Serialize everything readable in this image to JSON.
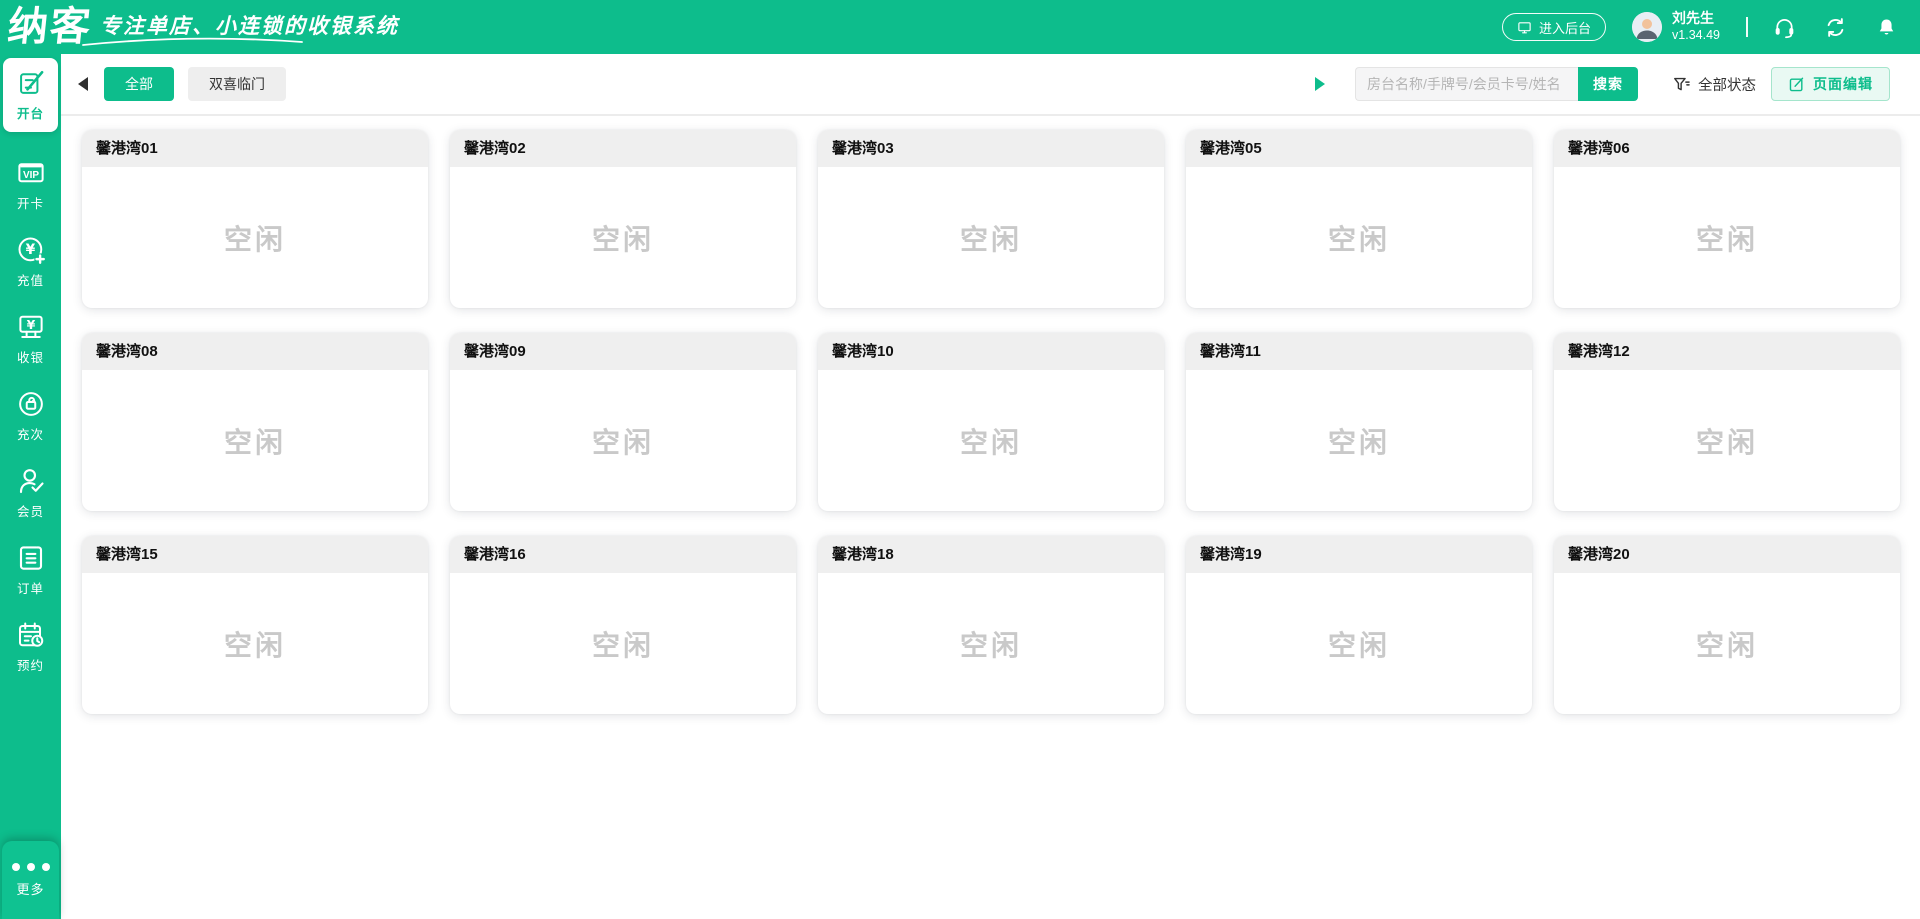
{
  "app": {
    "logo": "纳客",
    "slogan": "专注单店、小连锁的收银系统"
  },
  "header": {
    "backstage_button": "进入后台",
    "user": {
      "name": "刘先生",
      "version": "v1.34.49"
    },
    "icons": [
      "monitor-icon",
      "avatar",
      "headset-icon",
      "sync-icon",
      "bell-icon"
    ]
  },
  "sidebar": {
    "items": [
      {
        "label": "开台",
        "icon": "open-table-edit-icon",
        "active": true
      },
      {
        "label": "开卡",
        "icon": "vip-card-icon",
        "badge_text": "VIP",
        "active": false
      },
      {
        "label": "充值",
        "icon": "recharge-yen-plus-icon",
        "currency_glyph": "¥",
        "active": false
      },
      {
        "label": "收银",
        "icon": "cashier-monitor-icon",
        "currency_glyph": "¥",
        "active": false
      },
      {
        "label": "充次",
        "icon": "recharge-times-icon",
        "active": false
      },
      {
        "label": "会员",
        "icon": "member-check-icon",
        "active": false
      },
      {
        "label": "订单",
        "icon": "orders-clipboard-icon",
        "active": false
      },
      {
        "label": "预约",
        "icon": "reservation-calendar-clock-icon",
        "active": false
      }
    ],
    "more": {
      "label": "更多",
      "icon": "ellipsis-icon"
    }
  },
  "toolbar": {
    "tabs": [
      {
        "label": "全部",
        "active": true
      },
      {
        "label": "双喜临门",
        "active": false
      }
    ],
    "search": {
      "placeholder": "房台名称/手牌号/会员卡号/姓名",
      "button": "搜索"
    },
    "status_filter": {
      "label": "全部状态",
      "icon": "filter-funnel-icon"
    },
    "page_edit": {
      "label": "页面编辑",
      "icon": "edit-square-icon"
    }
  },
  "rooms": {
    "cards": [
      {
        "name": "馨港湾01",
        "status": "空闲"
      },
      {
        "name": "馨港湾02",
        "status": "空闲"
      },
      {
        "name": "馨港湾03",
        "status": "空闲"
      },
      {
        "name": "馨港湾05",
        "status": "空闲"
      },
      {
        "name": "馨港湾06",
        "status": "空闲"
      },
      {
        "name": "馨港湾08",
        "status": "空闲"
      },
      {
        "name": "馨港湾09",
        "status": "空闲"
      },
      {
        "name": "馨港湾10",
        "status": "空闲"
      },
      {
        "name": "馨港湾11",
        "status": "空闲"
      },
      {
        "name": "馨港湾12",
        "status": "空闲"
      },
      {
        "name": "馨港湾15",
        "status": "空闲"
      },
      {
        "name": "馨港湾16",
        "status": "空闲"
      },
      {
        "name": "馨港湾18",
        "status": "空闲"
      },
      {
        "name": "馨港湾19",
        "status": "空闲"
      },
      {
        "name": "馨港湾20",
        "status": "空闲"
      }
    ]
  },
  "colors": {
    "brand_green": "#0dbd8c",
    "card_header_bg": "#efefef",
    "idle_text": "#c9c9c9",
    "toolbar_divider": "#ececec",
    "inactive_tab_bg": "#eeeeee",
    "page_edit_bg": "#e9f9f3",
    "page_edit_border": "#a5e5cc"
  }
}
